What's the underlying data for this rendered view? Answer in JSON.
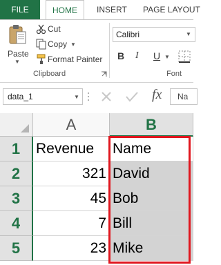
{
  "ribbon_tabs": {
    "file": "FILE",
    "home": "HOME",
    "insert": "INSERT",
    "page_layout": "PAGE LAYOUT"
  },
  "clipboard": {
    "paste": "Paste",
    "cut": "Cut",
    "copy": "Copy",
    "format_painter": "Format Painter",
    "group_label": "Clipboard"
  },
  "font": {
    "name": "Calibri",
    "bold": "B",
    "italic": "I",
    "underline": "U",
    "group_label": "Font"
  },
  "formula_bar": {
    "name_box": "data_1",
    "fx": "fx",
    "content": "Na"
  },
  "grid": {
    "columns": [
      "A",
      "B"
    ],
    "rows": [
      {
        "num": "1",
        "a": "Revenue",
        "b": "Name"
      },
      {
        "num": "2",
        "a": "321",
        "b": "David"
      },
      {
        "num": "3",
        "a": "45",
        "b": "Bob"
      },
      {
        "num": "4",
        "a": "7",
        "b": "Bill"
      },
      {
        "num": "5",
        "a": "23",
        "b": "Mike"
      }
    ]
  },
  "colors": {
    "accent": "#217346",
    "selection_highlight": "#e0161e"
  }
}
